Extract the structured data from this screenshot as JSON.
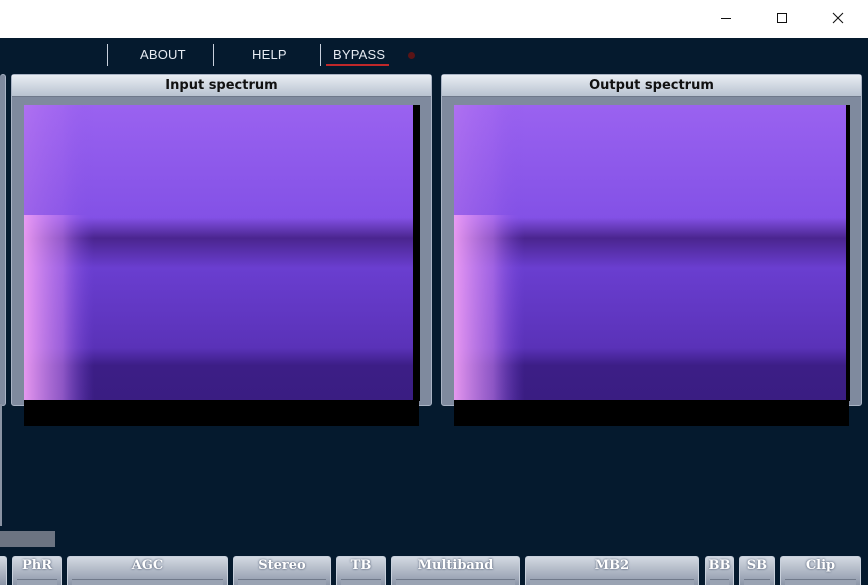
{
  "window": {
    "controls": [
      "minimize-icon",
      "maximize-icon",
      "close-icon"
    ]
  },
  "menu": {
    "about": "ABOUT",
    "help": "HELP",
    "bypass": "BYPASS"
  },
  "panels": {
    "input_title": "Input spectrum",
    "output_title": "Output spectrum"
  },
  "tabs": [
    {
      "label": "PhR"
    },
    {
      "label": "AGC"
    },
    {
      "label": "Stereo"
    },
    {
      "label": "TB"
    },
    {
      "label": "Multiband"
    },
    {
      "label": "MB2"
    },
    {
      "label": "BB"
    },
    {
      "label": "SB"
    },
    {
      "label": "Clip"
    }
  ],
  "colors": {
    "background": "#051a2e",
    "bypass_accent": "#c0282a",
    "spectrum_hot": "#e58cf2",
    "spectrum_mid": "#8f55ec",
    "spectrum_low": "#3c1e86"
  }
}
